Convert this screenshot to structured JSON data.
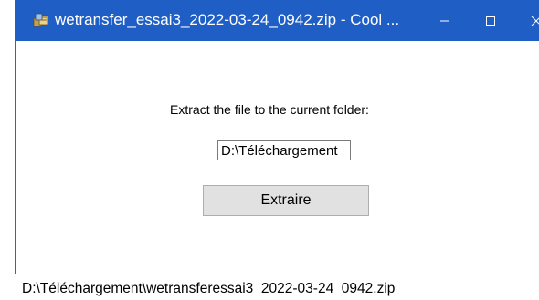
{
  "window": {
    "title": "wetransfer_essai3_2022-03-24_0942.zip - Cool ...",
    "app_icon": "archive-app-icon",
    "controls": {
      "minimize_icon": "minimize-icon",
      "maximize_icon": "maximize-icon",
      "close_icon": "close-icon"
    },
    "accent_color": "#1f5ec4"
  },
  "main": {
    "prompt": "Extract the file to the current folder:",
    "destination_value": "D:\\Téléchargement",
    "extract_label": "Extraire"
  },
  "status": {
    "archive_path": "D:\\Téléchargement\\wetransferessai3_2022-03-24_0942.zip"
  }
}
